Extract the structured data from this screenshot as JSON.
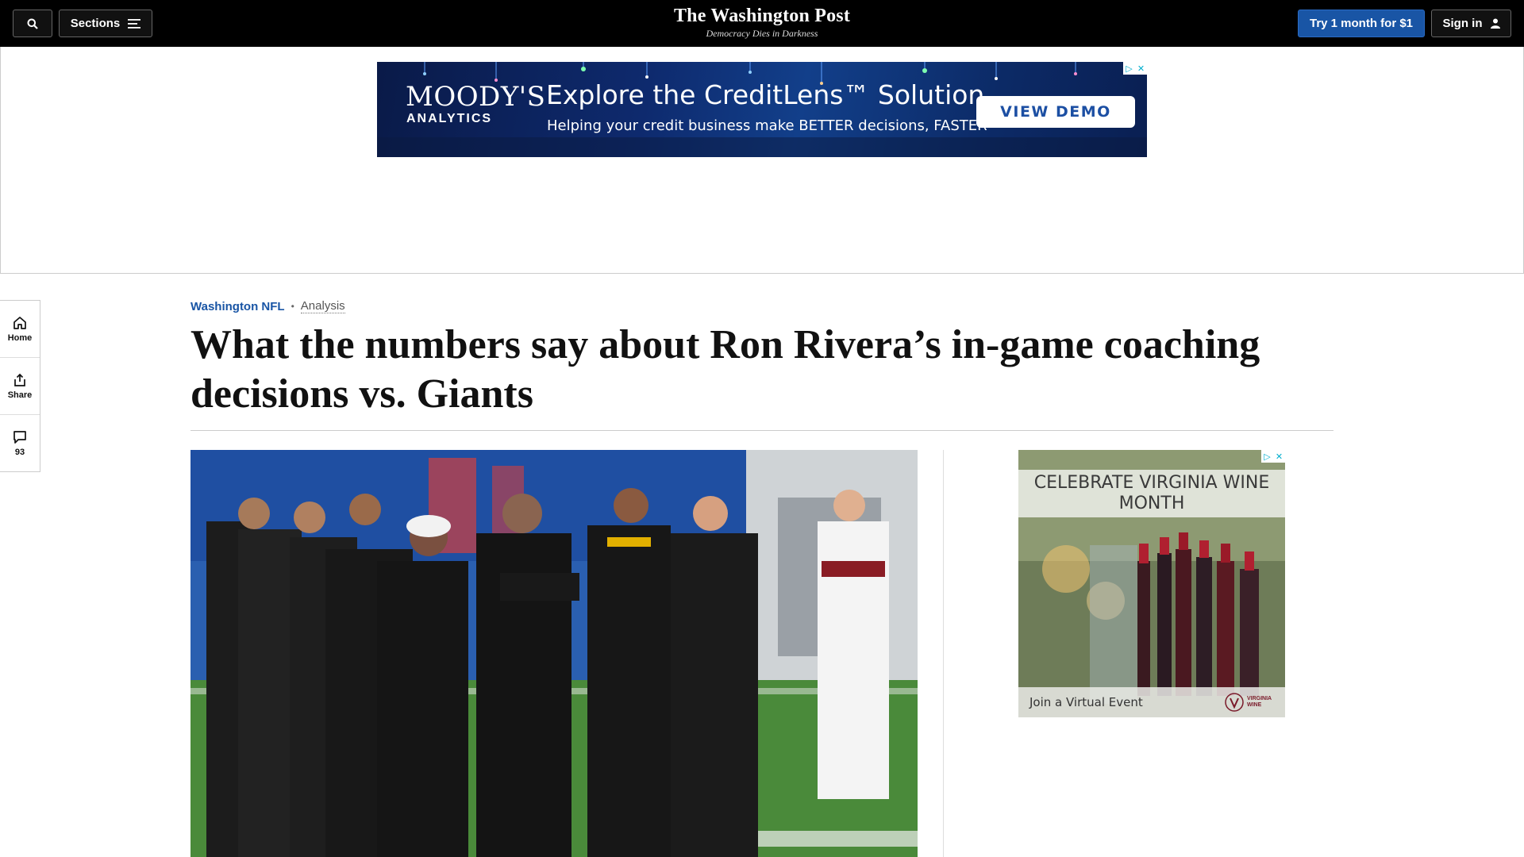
{
  "header": {
    "sections_label": "Sections",
    "logo_name": "The Washington Post",
    "tagline": "Democracy Dies in Darkness",
    "subscribe_label": "Try 1 month for $1",
    "signin_label": "Sign in",
    "colors": {
      "bar": "#000000",
      "subscribe": "#1955a5"
    }
  },
  "top_ad": {
    "brand": "MOODY'S",
    "brand_sub": "ANALYTICS",
    "headline": "Explore the CreditLens™ Solution",
    "subline": "Helping your credit business make BETTER decisions, FASTER",
    "cta": "VIEW DEMO",
    "adchoices_icon": "adchoices-icon"
  },
  "rail": {
    "items": [
      {
        "label": "Home",
        "icon": "home-icon"
      },
      {
        "label": "Share",
        "icon": "share-icon"
      },
      {
        "label": "93",
        "icon": "comment-icon"
      }
    ]
  },
  "article": {
    "section": "Washington NFL",
    "separator": "•",
    "label": "Analysis",
    "headline": "What the numbers say about Ron Rivera’s in-game coaching decisions vs. Giants"
  },
  "side_ad": {
    "title": "CELEBRATE VIRGINIA WINE MONTH",
    "cta": "Join a Virtual Event",
    "brand": "VIRGINIA WINE"
  }
}
